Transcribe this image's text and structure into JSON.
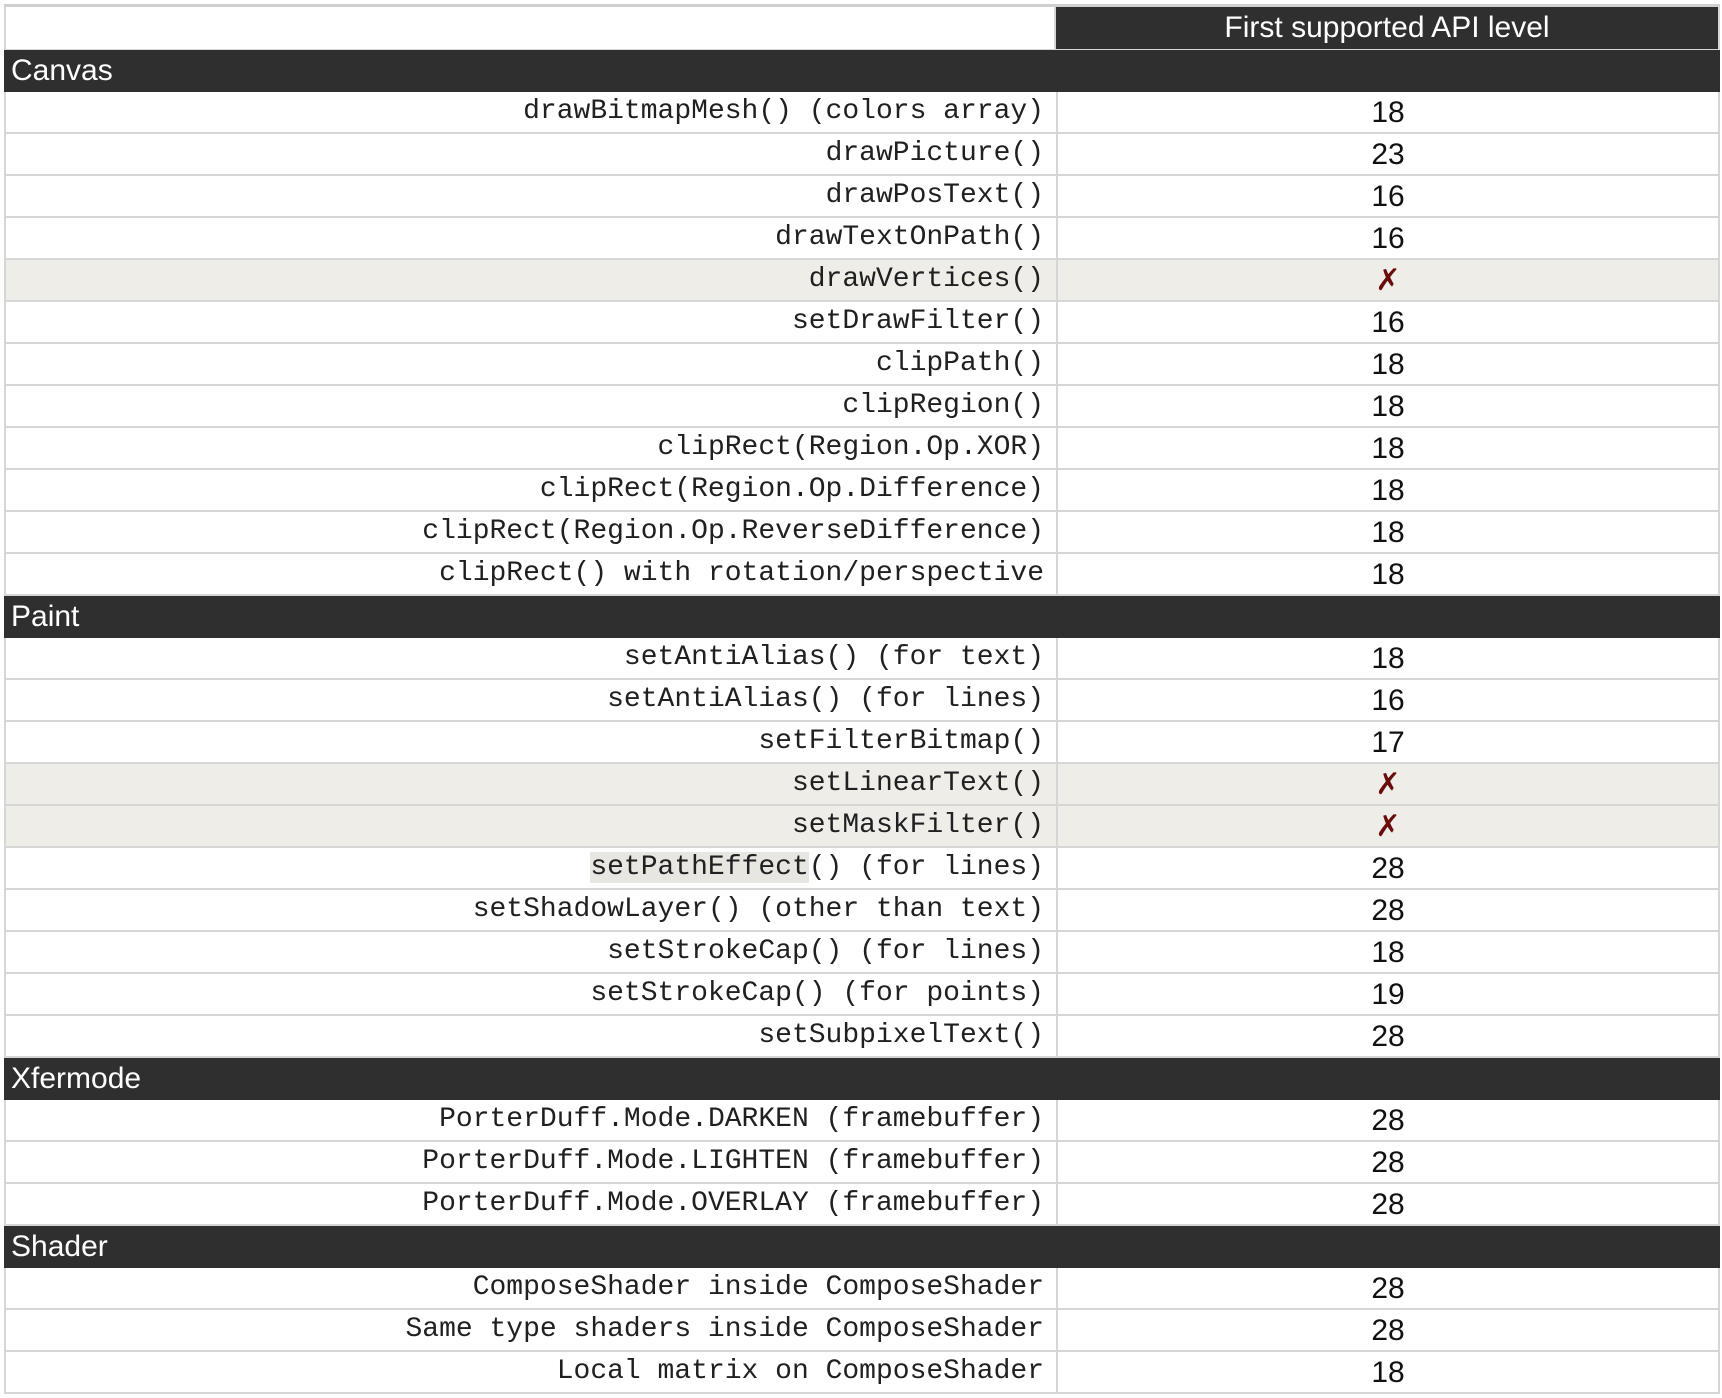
{
  "header": {
    "api_col": "First supported API level"
  },
  "sections": [
    {
      "title": "Canvas",
      "rows": [
        {
          "api": "drawBitmapMesh() (colors array)",
          "level": "18",
          "supported": true
        },
        {
          "api": "drawPicture()",
          "level": "23",
          "supported": true
        },
        {
          "api": "drawPosText()",
          "level": "16",
          "supported": true
        },
        {
          "api": "drawTextOnPath()",
          "level": "16",
          "supported": true
        },
        {
          "api": "drawVertices()",
          "level": "✗",
          "supported": false
        },
        {
          "api": "setDrawFilter()",
          "level": "16",
          "supported": true
        },
        {
          "api": "clipPath()",
          "level": "18",
          "supported": true
        },
        {
          "api": "clipRegion()",
          "level": "18",
          "supported": true
        },
        {
          "api": "clipRect(Region.Op.XOR)",
          "level": "18",
          "supported": true
        },
        {
          "api": "clipRect(Region.Op.Difference)",
          "level": "18",
          "supported": true
        },
        {
          "api": "clipRect(Region.Op.ReverseDifference)",
          "level": "18",
          "supported": true
        },
        {
          "api": "clipRect() with rotation/perspective",
          "level": "18",
          "supported": true
        }
      ]
    },
    {
      "title": "Paint",
      "rows": [
        {
          "api": "setAntiAlias() (for text)",
          "level": "18",
          "supported": true
        },
        {
          "api": "setAntiAlias() (for lines)",
          "level": "16",
          "supported": true
        },
        {
          "api": "setFilterBitmap()",
          "level": "17",
          "supported": true
        },
        {
          "api": "setLinearText()",
          "level": "✗",
          "supported": false
        },
        {
          "api": "setMaskFilter()",
          "level": "✗",
          "supported": false
        },
        {
          "api": "setPathEffect() (for lines)",
          "level": "28",
          "supported": true,
          "highlight": "setPathEffect"
        },
        {
          "api": "setShadowLayer() (other than text)",
          "level": "28",
          "supported": true
        },
        {
          "api": "setStrokeCap() (for lines)",
          "level": "18",
          "supported": true
        },
        {
          "api": "setStrokeCap() (for points)",
          "level": "19",
          "supported": true
        },
        {
          "api": "setSubpixelText()",
          "level": "28",
          "supported": true
        }
      ]
    },
    {
      "title": "Xfermode",
      "rows": [
        {
          "api": "PorterDuff.Mode.DARKEN (framebuffer)",
          "level": "28",
          "supported": true
        },
        {
          "api": "PorterDuff.Mode.LIGHTEN (framebuffer)",
          "level": "28",
          "supported": true
        },
        {
          "api": "PorterDuff.Mode.OVERLAY (framebuffer)",
          "level": "28",
          "supported": true
        }
      ]
    },
    {
      "title": "Shader",
      "rows": [
        {
          "api": "ComposeShader inside ComposeShader",
          "level": "28",
          "supported": true
        },
        {
          "api": "Same type shaders inside ComposeShader",
          "level": "28",
          "supported": true
        },
        {
          "api": "Local matrix on ComposeShader",
          "level": "18",
          "supported": true
        }
      ]
    }
  ],
  "colors": {
    "header_bg": "#2f2f2f",
    "unsupported_bg": "#efede8",
    "cross": "#6b0c0c"
  }
}
